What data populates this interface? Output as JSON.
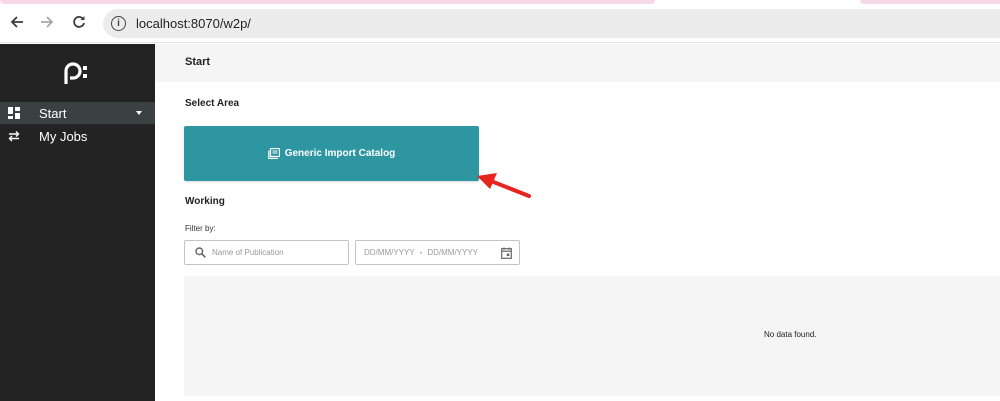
{
  "browser": {
    "url": "localhost:8070/w2p/"
  },
  "sidebar": {
    "items": [
      {
        "label": "Start",
        "icon": "dashboard-icon",
        "active": true
      },
      {
        "label": "My Jobs",
        "icon": "swap-icon",
        "active": false
      }
    ]
  },
  "main": {
    "title": "Start",
    "select_area_label": "Select Area",
    "catalog_card_label": "Generic Import Catalog",
    "working_label": "Working",
    "filter_label": "Filter by:",
    "search_placeholder": "Name of Publication",
    "date_from_placeholder": "DD/MM/YYYY",
    "date_separator": "-",
    "date_to_placeholder": "DD/MM/YYYY",
    "empty_message": "No data found."
  },
  "colors": {
    "sidebar_bg": "#232323",
    "sidebar_active": "#3a4143",
    "accent": "#2e96a1",
    "annotation_arrow": "#e8241f"
  }
}
